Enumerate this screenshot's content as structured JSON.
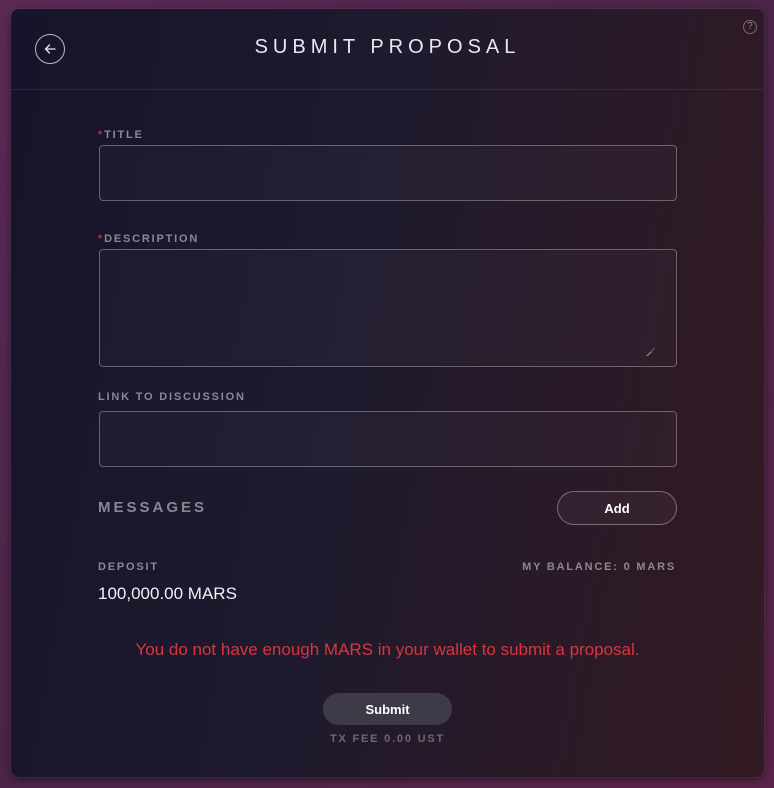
{
  "header": {
    "title": "SUBMIT PROPOSAL"
  },
  "form": {
    "title_label": "TITLE",
    "title_value": "",
    "description_label": "DESCRIPTION",
    "description_value": "",
    "link_label": "LINK TO DISCUSSION",
    "link_value": "",
    "required_mark": "*"
  },
  "messages": {
    "label": "MESSAGES",
    "add_label": "Add"
  },
  "deposit": {
    "label": "DEPOSIT",
    "value": "100,000.00 MARS",
    "balance": "MY BALANCE: 0 MARS"
  },
  "warning": "You do not have enough MARS in your wallet to submit a proposal.",
  "submit": {
    "label": "Submit",
    "tx_fee": "TX FEE 0.00 UST"
  },
  "help": {
    "icon": "?"
  },
  "colors": {
    "warning": "#d6363f",
    "required": "#c0303c",
    "submit_bg": "#3e3a48"
  }
}
